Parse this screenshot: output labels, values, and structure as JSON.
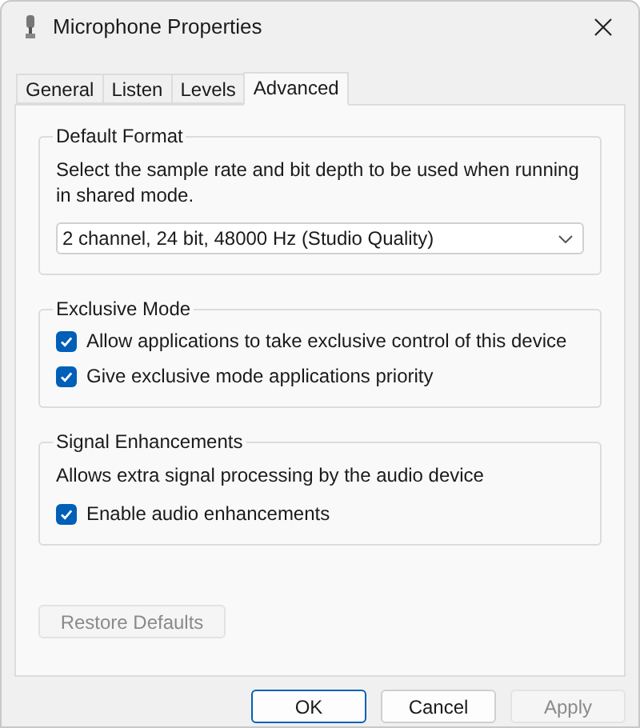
{
  "window": {
    "title": "Microphone Properties"
  },
  "tabs": [
    {
      "label": "General",
      "selected": false
    },
    {
      "label": "Listen",
      "selected": false
    },
    {
      "label": "Levels",
      "selected": false
    },
    {
      "label": "Advanced",
      "selected": true
    }
  ],
  "default_format": {
    "title": "Default Format",
    "description": "Select the sample rate and bit depth to be used when running in shared mode.",
    "format_select": {
      "value": "2 channel, 24 bit, 48000 Hz (Studio Quality)"
    }
  },
  "exclusive_mode": {
    "title": "Exclusive Mode",
    "options": [
      {
        "label": "Allow applications to take exclusive control of this device",
        "checked": true
      },
      {
        "label": "Give exclusive mode applications priority",
        "checked": true
      }
    ]
  },
  "signal_enhancements": {
    "title": "Signal Enhancements",
    "description": "Allows extra signal processing by the audio device",
    "options": [
      {
        "label": "Enable audio enhancements",
        "checked": true
      }
    ]
  },
  "restore_defaults": {
    "label": "Restore Defaults",
    "disabled": true
  },
  "buttons": [
    {
      "label": "OK",
      "default": true,
      "disabled": false
    },
    {
      "label": "Cancel",
      "default": false,
      "disabled": false
    },
    {
      "label": "Apply",
      "default": false,
      "disabled": true
    }
  ]
}
